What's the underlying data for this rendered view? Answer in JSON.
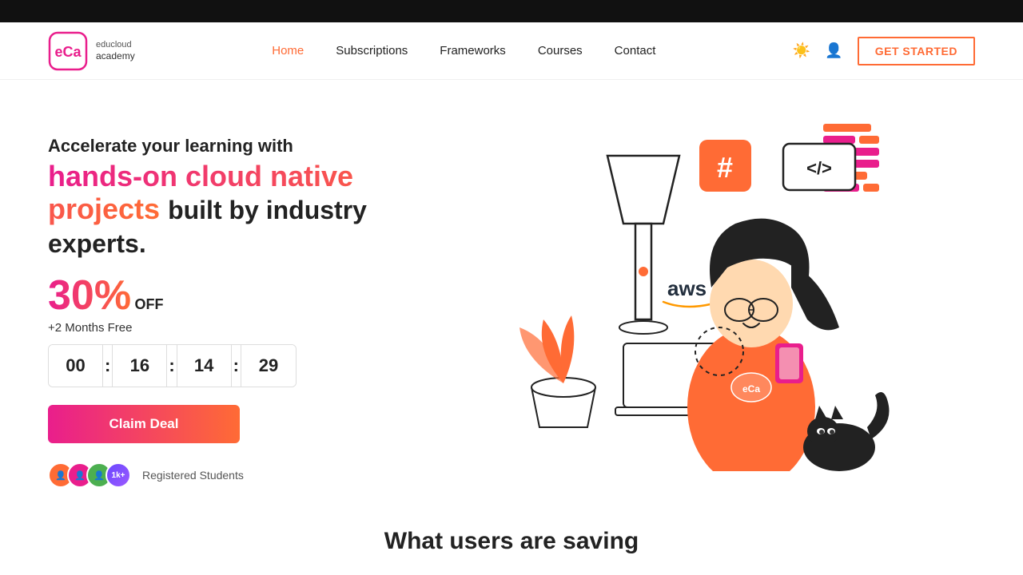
{
  "topbar": {
    "color": "#111"
  },
  "logo": {
    "text1": "educloud",
    "text2": "academy",
    "abbr": "eCa"
  },
  "nav": {
    "links": [
      {
        "label": "Home",
        "active": true
      },
      {
        "label": "Subscriptions",
        "active": false
      },
      {
        "label": "Frameworks",
        "active": false
      },
      {
        "label": "Courses",
        "active": false
      },
      {
        "label": "Contact",
        "active": false
      }
    ],
    "get_started": "GET STARTED"
  },
  "hero": {
    "subtitle": "Accelerate your learning with",
    "title_highlight": "hands-on cloud native projects",
    "title_normal": " built by industry experts.",
    "discount_amount": "30%",
    "discount_off": "OFF",
    "months_free": "+2 Months Free",
    "countdown": {
      "hours": "00",
      "minutes": "16",
      "seconds": "14",
      "ms": "29"
    },
    "claim_btn": "Claim Deal",
    "students_count": "1k+",
    "students_label": "Registered Students"
  },
  "section": {
    "what_users": "What users are saving"
  },
  "colors": {
    "accent_pink": "#E91E8C",
    "accent_orange": "#FF6B35",
    "accent_purple": "#6B48FF",
    "aws_orange": "#FF9900"
  }
}
